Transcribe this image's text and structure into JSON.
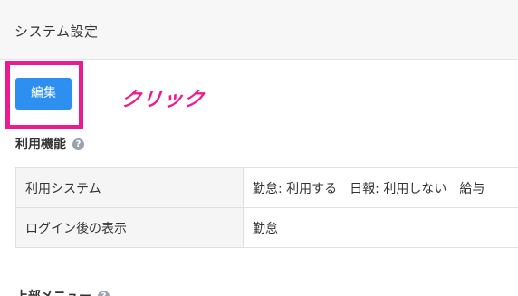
{
  "header": {
    "title": "システム設定"
  },
  "toolbar": {
    "edit_label": "編集"
  },
  "annotation": {
    "click_text": "クリック",
    "color": "#ea1c8f"
  },
  "sections": [
    {
      "title": "利用機能",
      "help_icon": "?",
      "rows": [
        {
          "label": "利用システム",
          "value": "勤怠: 利用する　日報: 利用しない　給与"
        },
        {
          "label": "ログイン後の表示",
          "value": "勤怠"
        }
      ]
    },
    {
      "title": "上部メニュー",
      "help_icon": "?"
    }
  ],
  "colors": {
    "primary_button": "#2d8ff0",
    "highlight": "#ea1c8f",
    "header_bg": "#f7f7f7"
  }
}
